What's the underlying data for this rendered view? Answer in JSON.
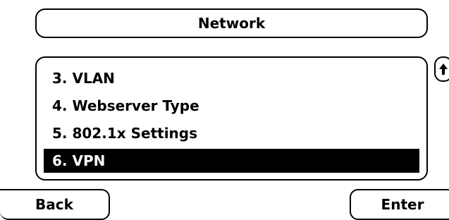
{
  "screen": {
    "title": "Network"
  },
  "menu": {
    "items": [
      {
        "label": "3. VLAN",
        "selected": false
      },
      {
        "label": "4. Webserver Type",
        "selected": false
      },
      {
        "label": "5. 802.1x Settings",
        "selected": false
      },
      {
        "label": "6. VPN",
        "selected": true
      }
    ]
  },
  "scroll": {
    "icon": "arrow-up-icon"
  },
  "softkeys": {
    "back_label": "Back",
    "enter_label": "Enter"
  },
  "colors": {
    "background": "#ffffff",
    "foreground": "#000000",
    "highlight_bg": "#000000",
    "highlight_fg": "#ffffff"
  }
}
